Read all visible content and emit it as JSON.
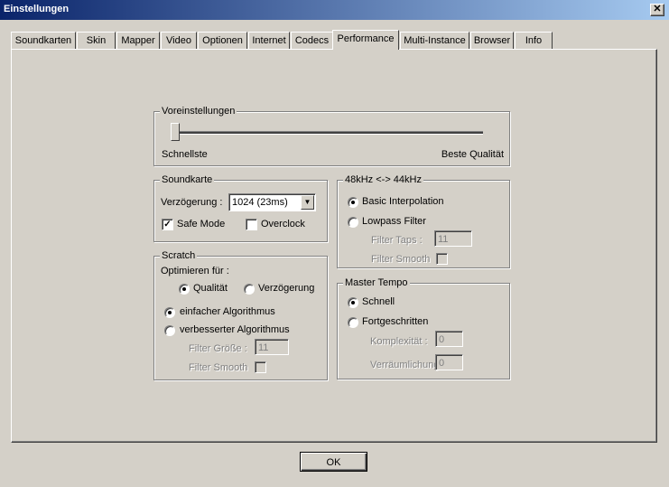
{
  "window": {
    "title": "Einstellungen",
    "close_glyph": "✕"
  },
  "tabs": [
    "Soundkarten",
    "Skin",
    "Mapper",
    "Video",
    "Optionen",
    "Internet",
    "Codecs",
    "Performance",
    "Multi-Instance",
    "Browser",
    "Info"
  ],
  "active_tab": "Performance",
  "presets": {
    "legend": "Voreinstellungen",
    "left_label": "Schnellste",
    "right_label": "Beste Qualität",
    "level": 0
  },
  "soundcard": {
    "legend": "Soundkarte",
    "delay_label": "Verzögerung :",
    "delay_value": "1024 (23ms)",
    "safe_mode_label": "Safe Mode",
    "safe_mode_checked": true,
    "overclock_label": "Overclock",
    "overclock_checked": false
  },
  "scratch": {
    "legend": "Scratch",
    "optimize_label": "Optimieren für :",
    "quality_label": "Qualität",
    "delay_label": "Verzögerung",
    "simple_label": "einfacher Algorithmus",
    "improved_label": "verbesserter Algorithmus",
    "filter_size_label": "Filter Größe :",
    "filter_size_value": "11",
    "filter_smooth_label": "Filter Smooth"
  },
  "resample": {
    "legend": "48kHz <-> 44kHz",
    "basic_label": "Basic Interpolation",
    "lowpass_label": "Lowpass Filter",
    "filter_taps_label": "Filter Taps :",
    "filter_taps_value": "11",
    "filter_smooth_label": "Filter Smooth"
  },
  "master_tempo": {
    "legend": "Master Tempo",
    "fast_label": "Schnell",
    "advanced_label": "Fortgeschritten",
    "complexity_label": "Komplexität :",
    "complexity_value": "0",
    "spatial_label": "Verräumlichung",
    "spatial_value": "0"
  },
  "ok_label": "OK"
}
